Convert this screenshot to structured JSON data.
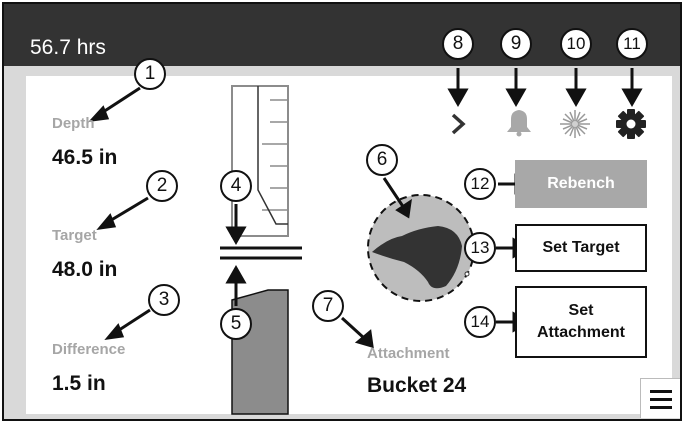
{
  "status_bar": {
    "hours": "56.7 hrs"
  },
  "readouts": {
    "depth": {
      "label": "Depth",
      "value": "46.5 in"
    },
    "target": {
      "label": "Target",
      "value": "48.0 in"
    },
    "difference": {
      "label": "Difference",
      "value": "1.5 in"
    },
    "attachment": {
      "label": "Attachment",
      "value": "Bucket 24"
    }
  },
  "buttons": {
    "rebench": "Rebench",
    "set_target": "Set Target",
    "set_attachment": "Set Attachment"
  },
  "header_icons": [
    "chevron-right-icon",
    "bell-icon",
    "laser-icon",
    "gear-icon"
  ],
  "menu_icon": "hamburger-menu-icon",
  "callouts": [
    "1",
    "2",
    "3",
    "4",
    "5",
    "6",
    "7",
    "8",
    "9",
    "10",
    "11",
    "12",
    "13",
    "14"
  ],
  "colors": {
    "topbar": "#333333",
    "rebench_button": "#a8a8a8",
    "label_gray": "#a6a6a6",
    "grade_shape": "#8c8c8c",
    "compass_fill": "#bdbdbd",
    "compass_shape": "#333333"
  }
}
